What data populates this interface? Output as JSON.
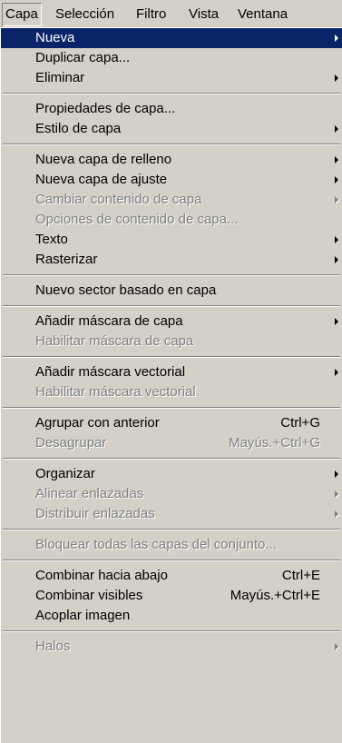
{
  "menubar": {
    "items": [
      {
        "label": "Capa",
        "active": true
      },
      {
        "label": "Selección"
      },
      {
        "label": "Filtro"
      },
      {
        "label": "Vista"
      },
      {
        "label": "Ventana"
      }
    ]
  },
  "colors": {
    "highlight": "#0a246a",
    "menu_bg": "#d4d0c8",
    "disabled_text": "#808080"
  },
  "menu": {
    "groups": [
      [
        {
          "label": "Nueva",
          "submenu": true,
          "highlighted": true
        },
        {
          "label": "Duplicar capa..."
        },
        {
          "label": "Eliminar",
          "submenu": true
        }
      ],
      [
        {
          "label": "Propiedades de capa..."
        },
        {
          "label": "Estilo de capa",
          "submenu": true
        }
      ],
      [
        {
          "label": "Nueva capa de relleno",
          "submenu": true
        },
        {
          "label": "Nueva capa de ajuste",
          "submenu": true
        },
        {
          "label": "Cambiar contenido de capa",
          "submenu": true,
          "disabled": true
        },
        {
          "label": "Opciones de contenido de capa...",
          "disabled": true
        },
        {
          "label": "Texto",
          "submenu": true
        },
        {
          "label": "Rasterizar",
          "submenu": true
        }
      ],
      [
        {
          "label": "Nuevo sector basado en capa"
        }
      ],
      [
        {
          "label": "Añadir máscara de capa",
          "submenu": true
        },
        {
          "label": "Habilitar máscara de capa",
          "disabled": true
        }
      ],
      [
        {
          "label": "Añadir máscara vectorial",
          "submenu": true
        },
        {
          "label": "Habilitar máscara vectorial",
          "disabled": true
        }
      ],
      [
        {
          "label": "Agrupar con anterior",
          "shortcut": "Ctrl+G"
        },
        {
          "label": "Desagrupar",
          "shortcut": "Mayús.+Ctrl+G",
          "disabled": true
        }
      ],
      [
        {
          "label": "Organizar",
          "submenu": true
        },
        {
          "label": "Alinear enlazadas",
          "submenu": true,
          "disabled": true
        },
        {
          "label": "Distribuir enlazadas",
          "submenu": true,
          "disabled": true
        }
      ],
      [
        {
          "label": "Bloquear todas las capas del conjunto...",
          "disabled": true
        }
      ],
      [
        {
          "label": "Combinar hacia abajo",
          "shortcut": "Ctrl+E"
        },
        {
          "label": "Combinar visibles",
          "shortcut": "Mayús.+Ctrl+E"
        },
        {
          "label": "Acoplar imagen"
        }
      ],
      [
        {
          "label": "Halos",
          "submenu": true,
          "disabled": true
        }
      ]
    ]
  }
}
